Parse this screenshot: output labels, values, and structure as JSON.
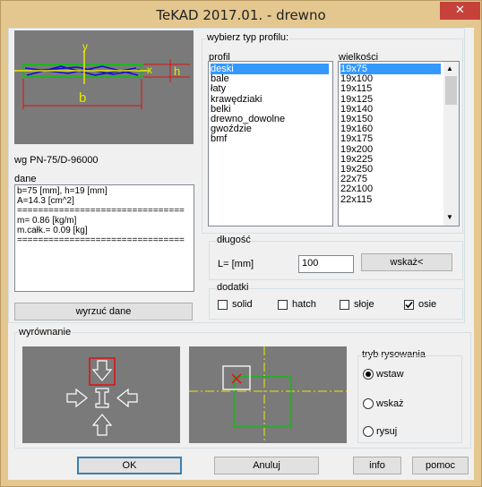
{
  "window": {
    "title": "TeKAD 2017.01. - drewno",
    "close_glyph": "✕"
  },
  "standard": "wg PN-75/D-96000",
  "dane": {
    "label": "dane",
    "lines": [
      "b=75 [mm], h=19 [mm]",
      "A=14.3 [cm^2]",
      "================================",
      "m= 0.86 [kg/m]",
      "m.całk.= 0.09 [kg]",
      "================================"
    ],
    "button": "wyrzuć dane"
  },
  "diagram": {
    "b_label": "b",
    "h_label": "h",
    "x_label": "x",
    "y_label": "y"
  },
  "profile": {
    "group_label": "wybierz typ profilu:",
    "profil_label": "profil",
    "profil_items": [
      "deski",
      "bale",
      "łaty",
      "krawędziaki",
      "belki",
      "drewno_dowolne",
      "gwoździe",
      "bmf"
    ],
    "profil_selected": 0,
    "size_label": "wielkości",
    "size_items": [
      "19x75",
      "19x100",
      "19x115",
      "19x125",
      "19x140",
      "19x150",
      "19x160",
      "19x175",
      "19x200",
      "19x225",
      "19x250",
      "22x75",
      "22x100",
      "22x115"
    ],
    "size_selected": 0
  },
  "length": {
    "group_label": "długość",
    "field_label": "L= [mm]",
    "value": "100",
    "button": "wskaż<"
  },
  "addons": {
    "group_label": "dodatki",
    "items": [
      {
        "label": "solid",
        "checked": false
      },
      {
        "label": "hatch",
        "checked": false
      },
      {
        "label": "słoje",
        "checked": false
      },
      {
        "label": "osie",
        "checked": true
      }
    ]
  },
  "alignment": {
    "group_label": "wyrównanie"
  },
  "mode": {
    "label": "tryb rysowania",
    "options": [
      {
        "label": "wstaw",
        "selected": true
      },
      {
        "label": "wskaż",
        "selected": false
      },
      {
        "label": "rysuj",
        "selected": false
      }
    ]
  },
  "buttons": {
    "ok": "OK",
    "cancel": "Anuluj",
    "info": "info",
    "help": "pomoc"
  },
  "colors": {
    "preview_bg": "#7a7a7a",
    "selection": "#3399ff",
    "frame": "#e4c78f",
    "close": "#c7413b"
  }
}
